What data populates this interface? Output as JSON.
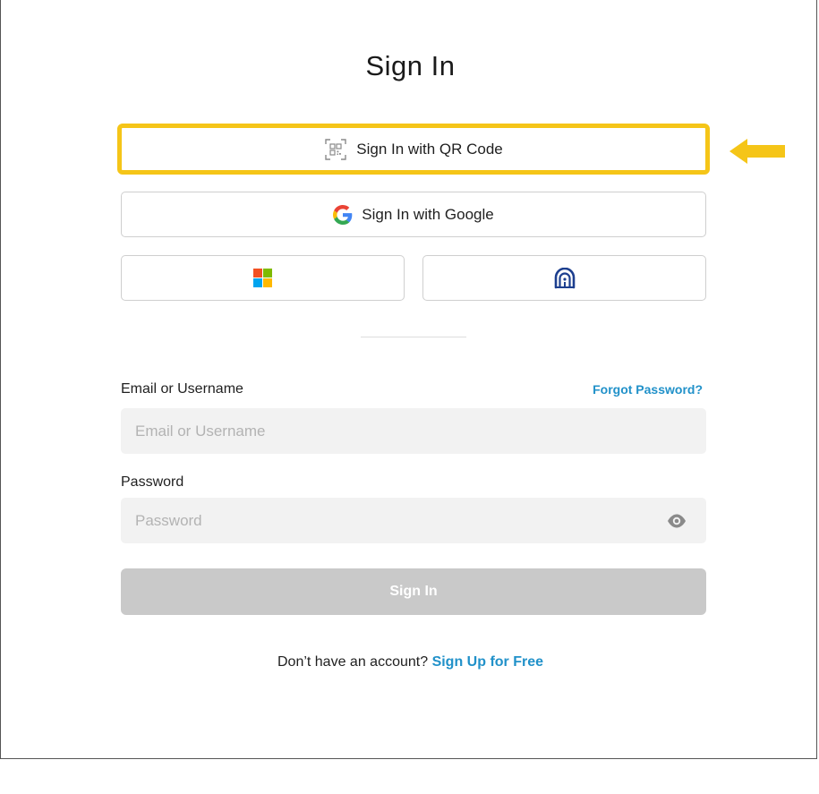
{
  "page": {
    "title": "Sign In"
  },
  "sso": {
    "qr_label": "Sign In with QR Code",
    "google_label": "Sign In with Google",
    "microsoft_icon": "microsoft-logo-icon",
    "other_icon": "house-logo-icon"
  },
  "form": {
    "email_label": "Email or Username",
    "email_placeholder": "Email or Username",
    "email_value": "",
    "forgot_label": "Forgot Password?",
    "password_label": "Password",
    "password_placeholder": "Password",
    "password_value": "",
    "submit_label": "Sign In"
  },
  "footer": {
    "prompt": "Don’t have an account?",
    "signup_label": "Sign Up for Free"
  },
  "colors": {
    "highlight": "#f5c518",
    "link": "#2191c9",
    "button_disabled": "#c9c9c9",
    "input_bg": "#f2f2f2"
  }
}
